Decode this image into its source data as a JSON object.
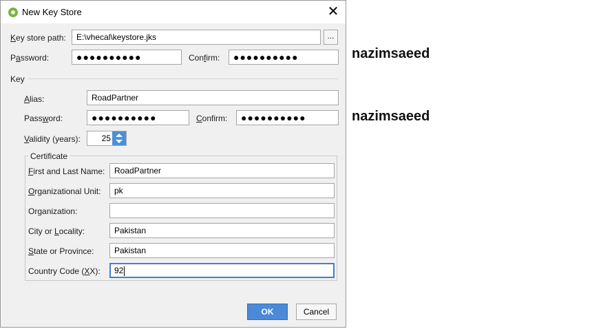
{
  "window": {
    "title": "New Key Store",
    "close_glyph": "✕"
  },
  "keystore": {
    "path_label_key": "K",
    "path_label_rest": "ey store path:",
    "path_value": "E:\\vhecal\\keystore.jks",
    "browse_label": "...",
    "password_label_pre": "P",
    "password_label_key": "a",
    "password_label_rest": "ssword:",
    "password_value": "●●●●●●●●●●",
    "confirm_label_pre": "Con",
    "confirm_label_key": "f",
    "confirm_label_rest": "irm:",
    "confirm_value": "●●●●●●●●●●"
  },
  "key": {
    "section_label": "Key",
    "alias_label_key": "A",
    "alias_label_rest": "lias:",
    "alias_value": "RoadPartner",
    "password_label_pre": "Pass",
    "password_label_key": "w",
    "password_label_rest": "ord:",
    "password_value": "●●●●●●●●●●",
    "confirm_label_key": "C",
    "confirm_label_rest": "onfirm:",
    "confirm_value": "●●●●●●●●●●",
    "validity_label_key": "V",
    "validity_label_rest": "alidity (years):",
    "validity_value": "25"
  },
  "certificate": {
    "group_label": "Certificate",
    "fields": [
      {
        "label_key": "F",
        "label_rest": "irst and Last Name:",
        "value": "RoadPartner"
      },
      {
        "label_key": "O",
        "label_rest": "rganizational Unit:",
        "value": "pk"
      },
      {
        "label_pre": "Or",
        "label_key": "g",
        "label_rest": "anization:",
        "value": ""
      },
      {
        "label_pre": "City or ",
        "label_key": "L",
        "label_rest": "ocality:",
        "value": "Pakistan"
      },
      {
        "label_key": "S",
        "label_rest": "tate or Province:",
        "value": "Pakistan"
      },
      {
        "label_pre": "Country Code (",
        "label_key": "X",
        "label_rest": "X):",
        "value": "92"
      }
    ]
  },
  "buttons": {
    "ok": "OK",
    "cancel": "Cancel"
  },
  "annotations": {
    "text_1": "nazimsaeed",
    "text_2": "nazimsaeed"
  },
  "colors": {
    "accent": "#4a8ad6",
    "focus_border": "#3d7fd6",
    "app_icon": "#7cb342"
  }
}
